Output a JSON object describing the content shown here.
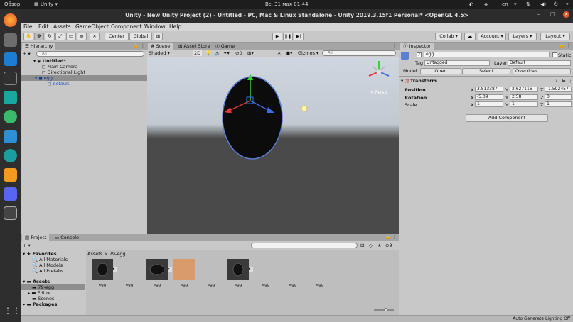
{
  "os_bar": {
    "overview": "Обзор",
    "app": "Unity",
    "datetime": "Вс, 31 мая  01:44",
    "lang": "en"
  },
  "dock": {
    "icons": [
      "firefox-icon",
      "files-icon",
      "vscode-icon",
      "terminal-icon",
      "gitkraken-icon",
      "gps-icon",
      "screen-icon",
      "signal-icon",
      "sublime-icon",
      "discord-icon",
      "unity-icon",
      "apps-grid-icon"
    ]
  },
  "window": {
    "title": "Unity - New Unity Project (2) - Untitled - PC, Mac & Linux Standalone - Unity 2019.3.15f1 Personal* <OpenGL 4.5>"
  },
  "menu": [
    "File",
    "Edit",
    "Assets",
    "GameObject",
    "Component",
    "Window",
    "Help"
  ],
  "toolbar": {
    "center": "Center",
    "global": "Global",
    "collab": "Collab",
    "account": "Account",
    "layers": "Layers",
    "layout": "Layout"
  },
  "hierarchy": {
    "tab": "Hierarchy",
    "search_placeholder": "All",
    "add": "+ ▾",
    "items": [
      "Untitled*",
      "Main Camera",
      "Directional Light",
      "egg",
      "default"
    ]
  },
  "scene": {
    "tabs": [
      "Scene",
      "Asset Store",
      "Game"
    ],
    "shading": "Shaded",
    "mode_2d": "2D",
    "gizmos": "Gizmos",
    "search_placeholder": "All",
    "persp": "< Persp",
    "layer_count": "0"
  },
  "inspector": {
    "tab": "Inspector",
    "object_name": "egg",
    "static": "Static",
    "tag_label": "Tag",
    "tag_value": "Untagged",
    "layer_label": "Layer",
    "layer_value": "Default",
    "model_label": "Model",
    "open": "Open",
    "select": "Select",
    "overrides": "Overrides",
    "transform": "Transform",
    "position_label": "Position",
    "rotation_label": "Rotation",
    "scale_label": "Scale",
    "position": {
      "x": "3.813387",
      "y": "2.627116",
      "z": "-1.592457"
    },
    "rotation": {
      "x": "-5.09",
      "y": "2.58",
      "z": "0"
    },
    "scale": {
      "x": "1",
      "y": "1",
      "z": "1"
    },
    "add_component": "Add Component"
  },
  "project": {
    "tabs": [
      "Project",
      "Console"
    ],
    "favorites": "Favorites",
    "fav_items": [
      "All Materials",
      "All Models",
      "All Prefabs"
    ],
    "assets": "Assets",
    "asset_folders": [
      "79-egg",
      "Editor",
      "Scenes"
    ],
    "packages": "Packages",
    "breadcrumb": "Assets > 79-egg",
    "file_labels": [
      "egg",
      "egg",
      "egg",
      "egg",
      "egg",
      "egg",
      "egg",
      "egg",
      "egg"
    ],
    "count": "9",
    "search_placeholder": ""
  },
  "status": {
    "text": "Auto Generate Lighting Off"
  }
}
